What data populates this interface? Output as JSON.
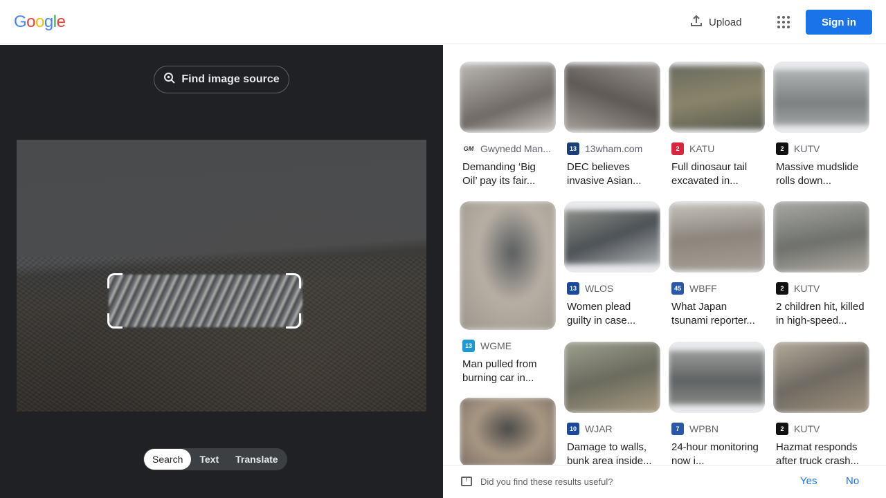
{
  "header": {
    "logo_letters": [
      "G",
      "o",
      "o",
      "g",
      "l",
      "e"
    ],
    "upload_label": "Upload",
    "signin_label": "Sign in"
  },
  "lens": {
    "find_source_label": "Find image source",
    "tabs": [
      "Search",
      "Text",
      "Translate"
    ],
    "active_tab": "Search"
  },
  "results": [
    {
      "source": "Gwynedd Man...",
      "title": "Demanding ‘Big Oil’ pay its fair...",
      "favicon": "GM",
      "favicon_color": "#ffffff",
      "thumb_color": "#8a8580"
    },
    {
      "source": "13wham.com",
      "title": "DEC believes invasive Asian...",
      "favicon": "13",
      "favicon_color": "#1c3f7a",
      "thumb_color": "#6f6a66"
    },
    {
      "source": "KATU",
      "title": "Full dinosaur tail excavated in...",
      "favicon": "2",
      "favicon_color": "#d7263d",
      "thumb_color": "#6d6a58"
    },
    {
      "source": "KUTV",
      "title": "Massive mudslide rolls down...",
      "favicon": "2",
      "favicon_color": "#111111",
      "thumb_color": "#8f9293"
    },
    {
      "source": "WGME",
      "title": "Man pulled from burning car in...",
      "favicon": "13",
      "favicon_color": "#1a9bd7",
      "thumb_color": "#9c968c"
    },
    {
      "source": "WLOS",
      "title": "Women plead guilty in case...",
      "favicon": "13",
      "favicon_color": "#1b4a9c",
      "thumb_color": "#6b7073"
    },
    {
      "source": "WBFF",
      "title": "What Japan tsunami reporter...",
      "favicon": "45",
      "favicon_color": "#2b57a8",
      "thumb_color": "#9a9690"
    },
    {
      "source": "KUTV",
      "title": "2 children hit, killed in high-speed...",
      "favicon": "2",
      "favicon_color": "#111111",
      "thumb_color": "#8a8983"
    },
    {
      "source": "",
      "title": "",
      "favicon": "",
      "favicon_color": "#ffffff",
      "thumb_color": "#7b6e63"
    },
    {
      "source": "WJAR",
      "title": "Damage to walls, bunk area inside...",
      "favicon": "10",
      "favicon_color": "#1b4a9c",
      "thumb_color": "#7c7a6d"
    },
    {
      "source": "WPBN",
      "title": "24-hour monitoring now i...",
      "favicon": "7",
      "favicon_color": "#2b57a8",
      "thumb_color": "#6c6f70"
    },
    {
      "source": "KUTV",
      "title": "Hazmat responds after truck crash...",
      "favicon": "2",
      "favicon_color": "#111111",
      "thumb_color": "#8b8478"
    }
  ],
  "feedback": {
    "question": "Did you find these results useful?",
    "yes_label": "Yes",
    "no_label": "No"
  }
}
